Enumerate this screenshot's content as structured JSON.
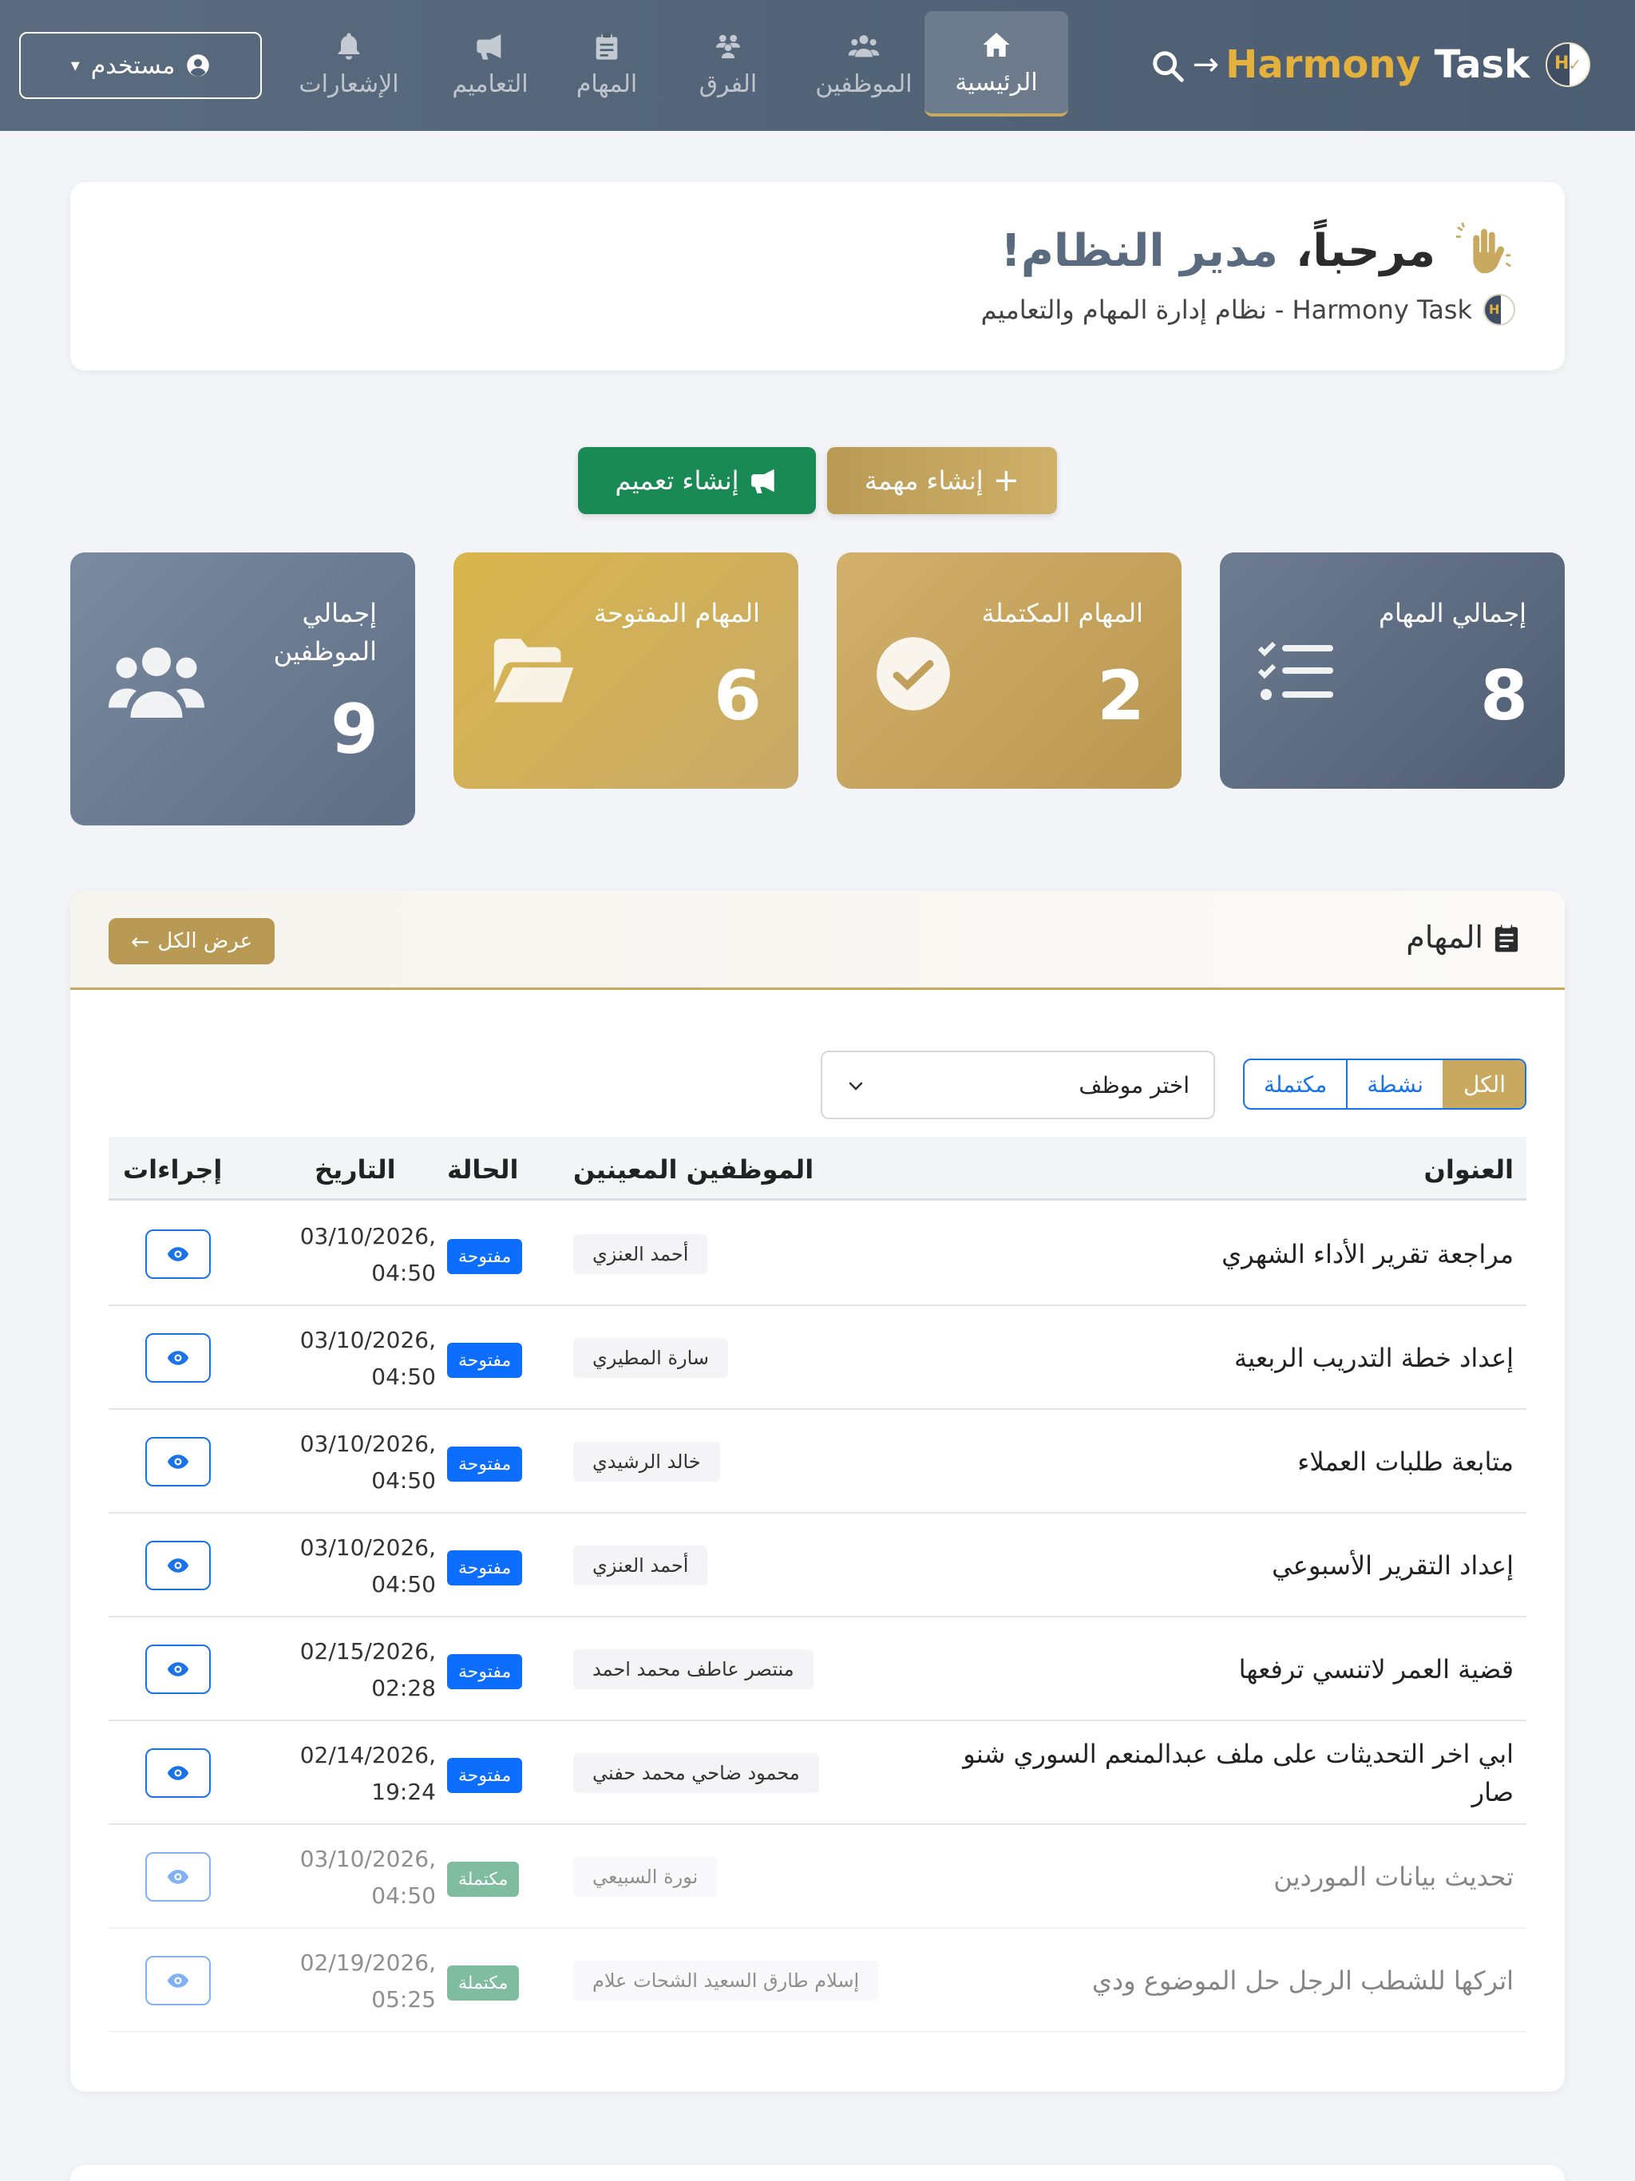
{
  "navbar": {
    "brand_part1": "Harmony",
    "brand_part2": "Task",
    "logo_letter": "H",
    "items": [
      {
        "label": "الرئيسية",
        "icon": "home-icon"
      },
      {
        "label": "الموظفين",
        "icon": "users-icon"
      },
      {
        "label": "الفرق",
        "icon": "team-icon"
      },
      {
        "label": "المهام",
        "icon": "clipboard-icon"
      },
      {
        "label": "التعاميم",
        "icon": "megaphone-icon"
      },
      {
        "label": "الإشعارات",
        "icon": "bell-icon"
      }
    ],
    "user_label": "مستخدم"
  },
  "welcome": {
    "greeting": "مرحباً،",
    "name": "مدير النظام!",
    "subtitle": "Harmony Task - نظام إدارة المهام والتعاميم"
  },
  "actions": {
    "create_task": "إنشاء مهمة",
    "create_broadcast": "إنشاء تعميم"
  },
  "stats": [
    {
      "label": "إجمالي المهام",
      "value": "8",
      "icon": "list-check-icon"
    },
    {
      "label": "المهام المكتملة",
      "value": "2",
      "icon": "check-circle-icon"
    },
    {
      "label": "المهام المفتوحة",
      "value": "6",
      "icon": "folder-open-icon"
    },
    {
      "label": "إجمالي الموظفين",
      "value": "9",
      "icon": "users-icon"
    }
  ],
  "tasks": {
    "title": "المهام",
    "view_all": "عرض الكل",
    "filters": [
      "الكل",
      "نشطة",
      "مكتملة"
    ],
    "active_filter": "الكل",
    "employee_select_placeholder": "اختر موظف",
    "columns": {
      "title": "العنوان",
      "employees": "الموظفين المعينين",
      "status": "الحالة",
      "date": "التاريخ",
      "actions": "إجراءات"
    },
    "rows": [
      {
        "title": "مراجعة تقرير الأداء الشهري",
        "employee": "أحمد العنزي",
        "status": "مفتوحة",
        "date": "03/10/2026,",
        "time": "04:50",
        "done": false
      },
      {
        "title": "إعداد خطة التدريب الربعية",
        "employee": "سارة المطيري",
        "status": "مفتوحة",
        "date": "03/10/2026,",
        "time": "04:50",
        "done": false
      },
      {
        "title": "متابعة طلبات العملاء",
        "employee": "خالد الرشيدي",
        "status": "مفتوحة",
        "date": "03/10/2026,",
        "time": "04:50",
        "done": false
      },
      {
        "title": "إعداد التقرير الأسبوعي",
        "employee": "أحمد العنزي",
        "status": "مفتوحة",
        "date": "03/10/2026,",
        "time": "04:50",
        "done": false
      },
      {
        "title": "قضية العمر لاتنسي ترفعها",
        "employee": "منتصر عاطف محمد احمد",
        "status": "مفتوحة",
        "date": "02/15/2026,",
        "time": "02:28",
        "done": false
      },
      {
        "title": "ابي اخر التحديثات على ملف عبدالمنعم السوري شنو صار",
        "employee": "محمود ضاحي محمد حفني",
        "status": "مفتوحة",
        "date": "02/14/2026,",
        "time": "19:24",
        "done": false
      },
      {
        "title": "تحديث بيانات الموردين",
        "employee": "نورة السبيعي",
        "status": "مكتملة",
        "date": "03/10/2026,",
        "time": "04:50",
        "done": true
      },
      {
        "title": "اتركها للشطب الرجل حل الموضوع ودي",
        "employee": "إسلام طارق السعيد الشحات علام",
        "status": "مكتملة",
        "date": "02/19/2026,",
        "time": "05:25",
        "done": true
      }
    ]
  },
  "colors": {
    "navbar": "#4c5d72",
    "gold": "#c9a860",
    "green": "#1a8a55",
    "primary": "#0d6efd"
  }
}
